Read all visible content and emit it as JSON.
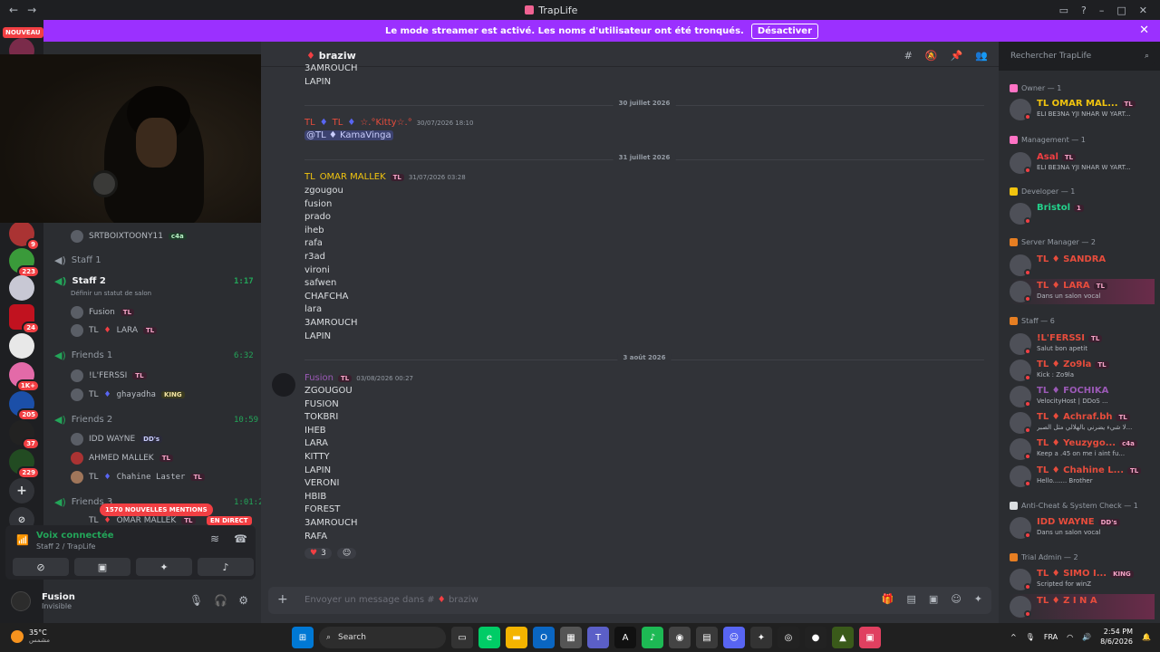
{
  "window": {
    "title": "TrapLife"
  },
  "banner": {
    "text": "Le mode streamer est activé. Les noms d'utilisateur ont été tronqués.",
    "button": "Désactiver"
  },
  "server_rail": {
    "nouveau": "NOUVEAU",
    "badges": [
      "501",
      "9",
      "223",
      "24",
      "1K+",
      "205",
      "37",
      "229"
    ]
  },
  "channels": {
    "partial_member": {
      "name": "SRTBOIXTOONY11",
      "tag": "c4a"
    },
    "voice": [
      {
        "name": "Staff 1",
        "timer": ""
      },
      {
        "name": "Staff 2",
        "timer": "1:17",
        "status_hint": "Définir un statut de salon"
      },
      {
        "name": "Friends 1",
        "timer": "6:32"
      },
      {
        "name": "Friends 2",
        "timer": "10:59"
      },
      {
        "name": "Friends 3",
        "timer": "1:01:27"
      }
    ],
    "staff2_members": [
      {
        "name": "Fusion",
        "tag": "TL"
      },
      {
        "name": "TL",
        "name2": "LARA",
        "tag": "TL"
      }
    ],
    "friends1_members": [
      {
        "name": "!L'FERSSI",
        "tag": "TL"
      },
      {
        "name": "TL",
        "name2": "ghayadha",
        "tag": "KING"
      }
    ],
    "friends2_members": [
      {
        "name": "IDD WAYNE",
        "tag": "DD's"
      },
      {
        "name": "AHMED MALLEK",
        "tag": "TL"
      },
      {
        "name": "TL",
        "name2": "Chahine Laster",
        "tag": "TL"
      }
    ],
    "friends3_partial": {
      "name": "TL",
      "name2": "OMAR MALLEK",
      "tag": "TL"
    },
    "mentions_pill": "1570 NOUVELLES MENTIONS",
    "live_badge": "EN DIRECT"
  },
  "voice_panel": {
    "title": "Voix connectée",
    "subtitle": "Staff 2 / TrapLife"
  },
  "user_panel": {
    "name": "Fusion",
    "status": "Invisible"
  },
  "chat": {
    "channel": "braziw",
    "top_lines": [
      "3AMROUCH",
      "LAPIN"
    ],
    "dates": [
      "30 juillet 2026",
      "31 juillet 2026",
      "3 août 2026"
    ],
    "msg1": {
      "author1": "TL",
      "author2": "TL",
      "author3": "☆.°Kitty☆.°",
      "time": "30/07/2026 18:10",
      "mention": "@TL ♦ KamaVinga"
    },
    "msg2": {
      "author": "TL",
      "author2": "OMAR MALLEK",
      "tag": "TL",
      "time": "31/07/2026 03:28",
      "lines": [
        "zgougou",
        "fusion",
        "prado",
        "iheb",
        "rafa",
        "r3ad",
        "vironi",
        "safwen",
        "CHAFCHA",
        "lara",
        "3AMROUCH",
        "LAPIN"
      ]
    },
    "msg3": {
      "author": "Fusion",
      "tag": "TL",
      "time": "03/08/2026 00:27",
      "lines": [
        "ZGOUGOU",
        "FUSION",
        "TOKBRI",
        "IHEB",
        "LARA",
        "KITTY",
        "LAPIN",
        "VERONI",
        "HBIB",
        "FOREST",
        "3AMROUCH",
        "RAFA"
      ]
    },
    "reaction_count": "3",
    "composer_placeholder": "Envoyer un message dans #",
    "composer_channel": "braziw"
  },
  "search": {
    "placeholder": "Rechercher TrapLife"
  },
  "members": {
    "groups": [
      {
        "label": "Owner — 1"
      },
      {
        "label": "Management — 1"
      },
      {
        "label": "Developer — 1"
      },
      {
        "label": "Server Manager — 2"
      },
      {
        "label": "Staff — 6"
      },
      {
        "label": "Anti-Cheat & System Check — 1"
      },
      {
        "label": "Trial Admin — 2"
      }
    ],
    "list": [
      {
        "name": "TL  OMAR MAL...",
        "tag": "TL",
        "status": "ELI BE3NA YJI NHAR W YART..."
      },
      {
        "name": "Asal",
        "tag": "TL",
        "status": "ELI BE3NA YJI NHAR W YART..."
      },
      {
        "name": "Bristol",
        "tag": "1",
        "status": ""
      },
      {
        "name": "TL ♦ SANDRA",
        "tag": "",
        "status": ""
      },
      {
        "name": "TL ♦ LARA",
        "tag": "TL",
        "status": "Dans un salon vocal"
      },
      {
        "name": "!L'FERSSI",
        "tag": "TL",
        "status": "Salut bon apetit"
      },
      {
        "name": "TL ♦ Zo9la",
        "tag": "TL",
        "status": "Kick : Zo9la"
      },
      {
        "name": "TL ♦ FOCHIKA",
        "tag": "",
        "status": "VelocityHost | DDoS ..."
      },
      {
        "name": "TL ♦ Achraf.bh",
        "tag": "TL",
        "status": "لا شيء يضرني بالهلالي مثل الصبر..."
      },
      {
        "name": "TL ♦ Yeuzygo...",
        "tag": "c4a",
        "status": "Keep a .45 on me i aint fu..."
      },
      {
        "name": "TL ♦ Chahine L...",
        "tag": "TL",
        "status": "Hello....... Brother"
      },
      {
        "name": "IDD WAYNE",
        "tag": "DD's",
        "status": "Dans un salon vocal"
      },
      {
        "name": "TL ♦ SIMO I...",
        "tag": "KING",
        "status": "Scripted for winZ"
      },
      {
        "name": "TL ♦ Z I N A",
        "tag": "",
        "status": ""
      }
    ]
  },
  "taskbar": {
    "temp": "35°C",
    "weather": "مشمس",
    "search": "Search",
    "lang": "FRA",
    "time": "2:54 PM",
    "date": "8/6/2026"
  }
}
